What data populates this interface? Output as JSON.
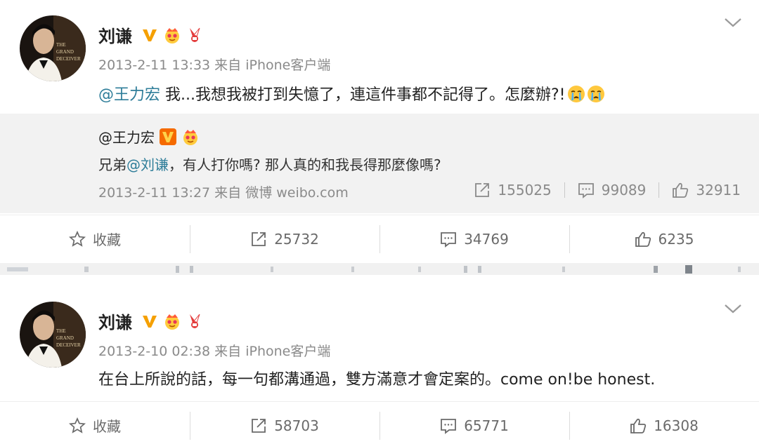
{
  "posts": [
    {
      "author": "刘谦",
      "meta": "2013-2-11 13:33 来自 iPhone客户端",
      "content": {
        "mention": "@王力宏",
        "text": " 我...我想我被打到失憶了，連這件事都不記得了。怎麼辦?!",
        "emojis": [
          "crying-emoji",
          "crying-emoji"
        ]
      },
      "repost": {
        "author": "@王力宏",
        "text_prefix": "兄弟",
        "mention": "@刘谦",
        "text_suffix": "，有人打你嗎? 那人真的和我長得那麼像嗎?",
        "meta": "2013-2-11 13:27 来自 微博 weibo.com",
        "reposts": "155025",
        "comments": "99089",
        "likes": "32911"
      },
      "actions": {
        "favorite": "收藏",
        "reposts": "25732",
        "comments": "34769",
        "likes": "6235"
      }
    },
    {
      "author": "刘谦",
      "meta": "2013-2-10 02:38 来自 iPhone客户端",
      "content": {
        "text": "在台上所說的話，每一句都溝通過，雙方滿意才會定案的。come on!be honest."
      },
      "actions": {
        "favorite": "收藏",
        "reposts": "58703",
        "comments": "65771",
        "likes": "16308"
      }
    }
  ],
  "colors": {
    "mention": "#2e7d99",
    "verified": "#f5a000",
    "muted": "#8a8a8a",
    "repost_bg": "#f2f2f2"
  }
}
